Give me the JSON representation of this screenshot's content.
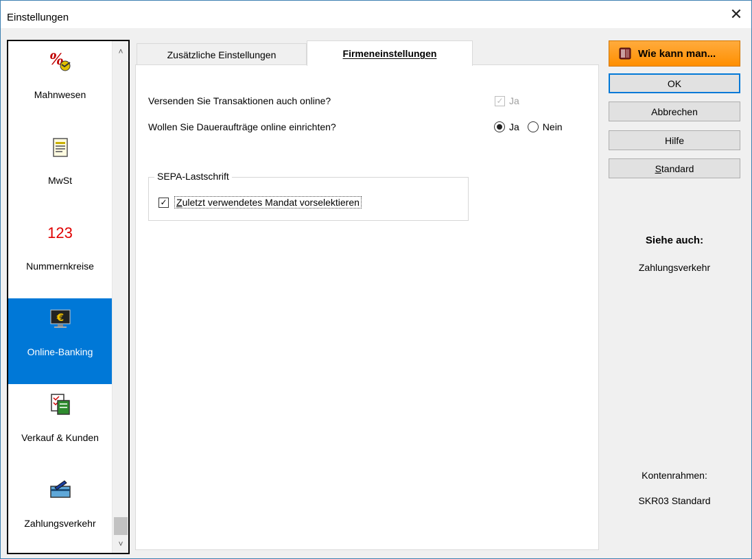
{
  "window": {
    "title": "Einstellungen",
    "close_glyph": "✕"
  },
  "nav": {
    "items": [
      {
        "label": "Mahnwesen",
        "icon": "dunning-percent-icon"
      },
      {
        "label": "MwSt",
        "icon": "document-icon"
      },
      {
        "label": "Nummernkreise",
        "icon": "numbers-123-icon",
        "icon_text": "123"
      },
      {
        "label": "Online-Banking",
        "icon": "monitor-euro-icon",
        "active": true
      },
      {
        "label": "Verkauf & Kunden",
        "icon": "sales-documents-icon"
      },
      {
        "label": "Zahlungsverkehr",
        "icon": "payment-card-icon"
      }
    ],
    "scroll_up": "˄",
    "scroll_down": "˅"
  },
  "tabs": [
    {
      "label": "Zusätzliche Einstellungen",
      "active": false
    },
    {
      "label": "Firmeneinstellungen",
      "active": true
    }
  ],
  "panel": {
    "q1": "Versenden Sie Transaktionen auch online?",
    "q1_check_label": "Ja",
    "q1_check_mark": "✓",
    "q2": "Wollen Sie Daueraufträge online einrichten?",
    "q2_options": [
      {
        "label": "Ja",
        "selected": true
      },
      {
        "label": "Nein",
        "selected": false
      }
    ],
    "group_title": "SEPA-Lastschrift",
    "group_check_first": "Z",
    "group_check_rest": "uletzt verwendetes Mandat vorselektieren",
    "group_check_mark": "✓"
  },
  "buttons": {
    "how_to": "Wie kann man...",
    "ok": "OK",
    "cancel": "Abbrechen",
    "help": "Hilfe",
    "standard_first": "S",
    "standard_rest": "tandard"
  },
  "side": {
    "see_also_title": "Siehe auch:",
    "see_also_link": "Zahlungsverkehr",
    "chart_label": "Kontenrahmen:",
    "chart_value": "SKR03 Standard"
  },
  "colors": {
    "accent": "#0078d7",
    "howto_orange": "#ff9a1f"
  }
}
